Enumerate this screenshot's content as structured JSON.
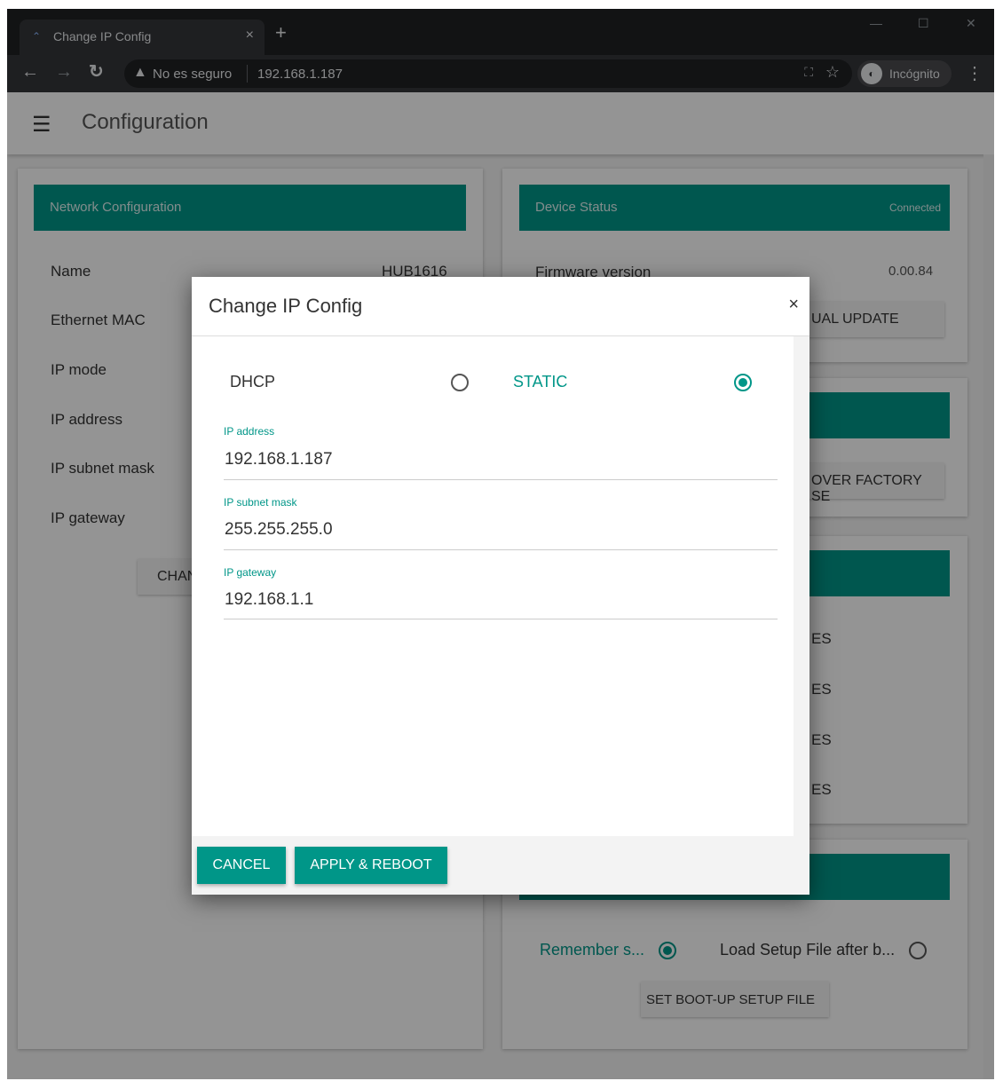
{
  "browser": {
    "tab_title": "Change IP Config",
    "tab_close": "×",
    "new_tab": "+",
    "security_text": "No es seguro",
    "url": "192.168.1.187",
    "profile_label": "Incógnito"
  },
  "app": {
    "title": "Configuration"
  },
  "network_card": {
    "header": "Network Configuration",
    "rows": [
      {
        "label": "Name",
        "value": "HUB1616"
      },
      {
        "label": "Ethernet MAC",
        "value": ""
      },
      {
        "label": "IP mode",
        "value": ""
      },
      {
        "label": "IP address",
        "value": ""
      },
      {
        "label": "IP subnet mask",
        "value": ""
      },
      {
        "label": "IP gateway",
        "value": ""
      }
    ],
    "change_button": "CHAN"
  },
  "device_card": {
    "header": "Device Status",
    "status": "Connected",
    "firmware_label": "Firmware version",
    "firmware_value": "0.00.84",
    "manual_update_button": "UAL UPDATE"
  },
  "factory_card": {
    "button": "OVER FACTORY SE"
  },
  "services_card": {
    "items": [
      "ES",
      "ES",
      "ES",
      "ES"
    ]
  },
  "bootup_card": {
    "remember_label": "Remember s...",
    "load_label": "Load Setup File after b...",
    "set_button": "SET BOOT-UP SETUP FILE"
  },
  "dialog": {
    "title": "Change IP Config",
    "close": "×",
    "mode_dhcp": "DHCP",
    "mode_static": "STATIC",
    "selected_mode": "STATIC",
    "fields": [
      {
        "label": "IP address",
        "value": "192.168.1.187"
      },
      {
        "label": "IP subnet mask",
        "value": "255.255.255.0"
      },
      {
        "label": "IP gateway",
        "value": "192.168.1.1"
      }
    ],
    "cancel": "CANCEL",
    "apply": "APPLY & REBOOT"
  },
  "colors": {
    "accent": "#009688",
    "browser_dark": "#202124",
    "overlay": "rgba(0,0,0,0.42)"
  },
  "icons": [
    "wifi-icon",
    "back-icon",
    "forward-icon",
    "reload-icon",
    "warning-icon",
    "translate-icon",
    "star-icon",
    "incognito-icon",
    "menu-icon",
    "hamburger-icon",
    "close-icon"
  ]
}
